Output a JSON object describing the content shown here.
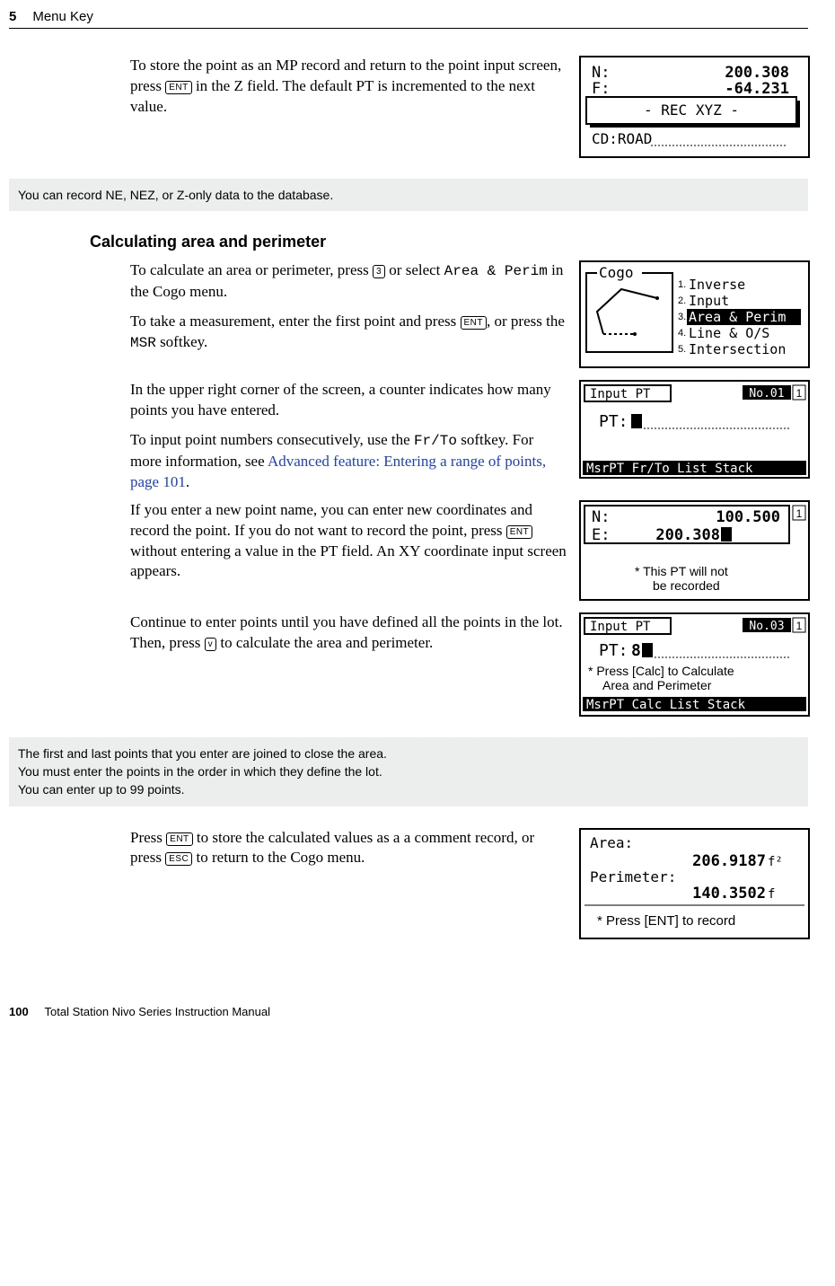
{
  "header": {
    "chapter_num": "5",
    "chapter_title": "Menu Key"
  },
  "para1": {
    "a": "To store the point as an MP record and return to the point input screen, press ",
    "key": "ENT",
    "b": " in the Z field. The default PT is incremented to the next value."
  },
  "note1": "You can record NE, NEZ, or Z-only data to the database.",
  "section_title": "Calculating area and perimeter",
  "para2": {
    "a": "To calculate an area or perimeter, press ",
    "key": "3",
    "b": " or select ",
    "mono": "Area & Perim",
    "c": " in the Cogo menu."
  },
  "para3": {
    "a": "To take a measurement, enter the first point and press ",
    "key": "ENT",
    "b": ", or press the ",
    "mono": "MSR",
    "c": " softkey."
  },
  "para4": "In the upper right corner of the screen, a counter indicates how many points you have entered.",
  "para5": {
    "a": "To input point numbers consecutively, use the ",
    "mono": "Fr/To",
    "b": " softkey. For more information, see ",
    "link": "Advanced feature: Entering a range of points, page 101",
    "c": "."
  },
  "para6": {
    "a": "If you enter a new point name, you can enter new coordinates and record the point. If you do not want to record the point, press ",
    "key": "ENT",
    "b": " without entering a value in the PT field. An XY coordinate input screen appears."
  },
  "para7": {
    "a": "Continue to enter points until you have defined all the points in the lot. Then, press ",
    "key": "v",
    "b": " to calculate the area and perimeter."
  },
  "note2": {
    "l1": "The first and last points that you enter are joined to close the area.",
    "l2": "You must enter the points in the order in which they define the lot.",
    "l3": "You can enter up to 99 points."
  },
  "para8": {
    "a": "Press ",
    "key1": "ENT",
    "b": " to store the calculated values as a a comment record, or press ",
    "key2": "ESC",
    "c": " to return to the Cogo menu."
  },
  "footer": {
    "page": "100",
    "title": "Total Station Nivo Series Instruction Manual"
  },
  "screens": {
    "s1": {
      "n": "N:",
      "nval": "200.308",
      "f": "F:",
      "fval": "-64.231",
      "rec": "- REC XYZ -",
      "cd": "CD:ROAD"
    },
    "s2": {
      "title": "Cogo",
      "m1": "Inverse",
      "m2": "Input",
      "m3": "Area & Perim",
      "m4": "Line & O/S",
      "m5": "Intersection"
    },
    "s3": {
      "title": "Input PT",
      "badge": "No.01",
      "pt": "PT:",
      "soft": "MsrPT Fr/To  List Stack"
    },
    "s4": {
      "n": "N:",
      "nval": "100.500",
      "e": "E:",
      "eval": "200.308",
      "note1": "* This PT will not",
      "note2": "be recorded"
    },
    "s5": {
      "title": "Input PT",
      "badge": "No.03",
      "pt": "PT:",
      "ptv": "8",
      "note1": "* Press [Calc] to Calculate",
      "note2": "Area and Perimeter",
      "soft": "MsrPT Calc  List Stack"
    },
    "s6": {
      "area": "Area:",
      "aval": "206.9187",
      "aunit": "f²",
      "per": "Perimeter:",
      "pval": "140.3502",
      "punit": "f",
      "note": "* Press [ENT] to record"
    }
  }
}
